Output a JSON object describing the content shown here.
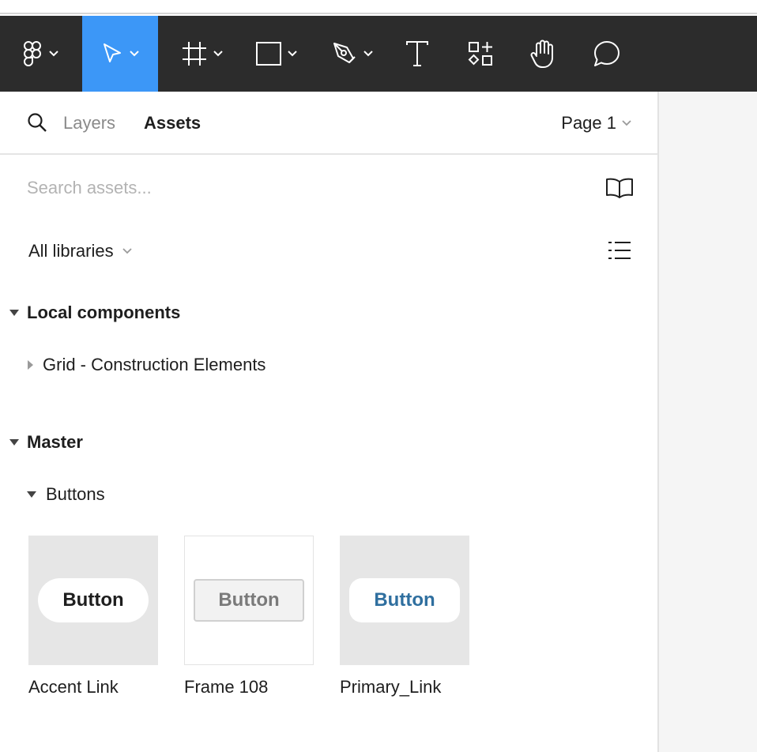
{
  "toolbar": {
    "tools": [
      "main-menu",
      "move",
      "frame",
      "shape",
      "pen",
      "text",
      "resources",
      "hand",
      "comment"
    ],
    "active_tool": "move",
    "accent_color": "#3c97f7",
    "background_color": "#2c2c2c"
  },
  "panel": {
    "tabs": {
      "layers": "Layers",
      "assets": "Assets"
    },
    "active_tab": "Assets",
    "page_selector": "Page 1",
    "search_placeholder": "Search assets...",
    "library_filter": "All libraries"
  },
  "sections": {
    "local": {
      "title": "Local components",
      "expanded": true,
      "child": "Grid - Construction Elements"
    },
    "master": {
      "title": "Master",
      "expanded": true,
      "group": "Buttons"
    }
  },
  "components": [
    {
      "name": "Accent Link",
      "preview_text": "Button",
      "text_color": "#1e1e1e"
    },
    {
      "name": "Frame 108",
      "preview_text": "Button",
      "text_color": "#7a7a7a"
    },
    {
      "name": "Primary_Link",
      "preview_text": "Button",
      "text_color": "#2f6f9f"
    }
  ]
}
